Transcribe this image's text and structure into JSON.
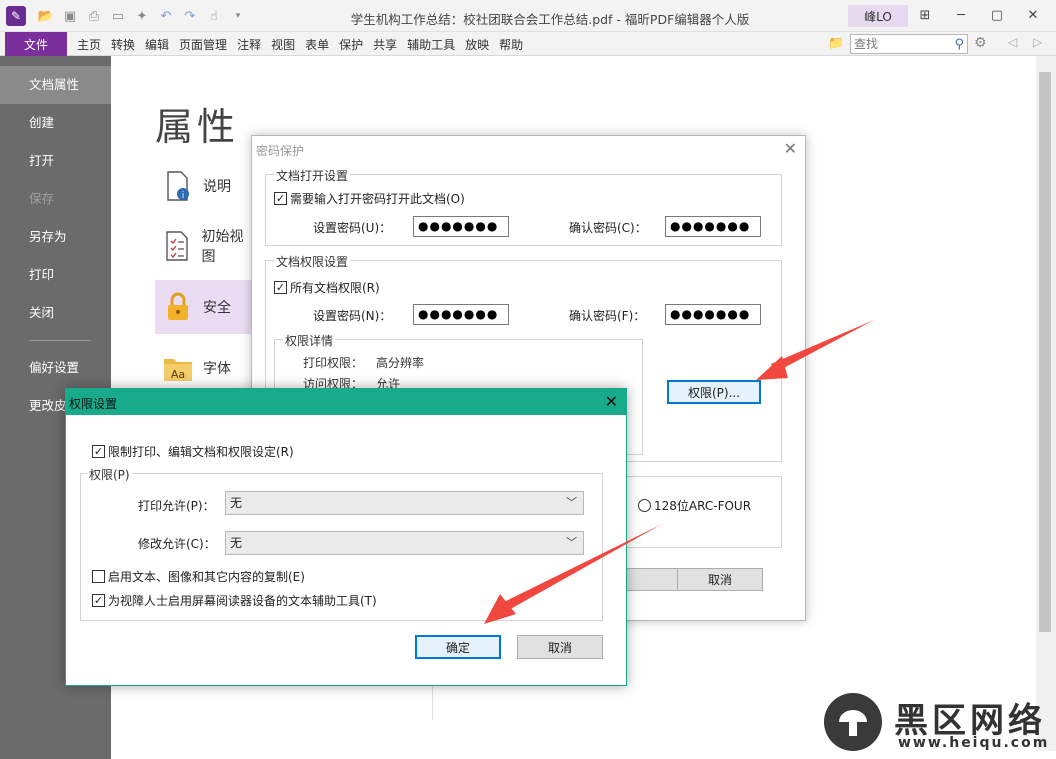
{
  "window": {
    "title": "学生机构工作总结：校社团联合会工作总结.pdf - 福昕PDF编辑器个人版",
    "user": "峰LO"
  },
  "menu": {
    "file": "文件",
    "items": [
      "主页",
      "转换",
      "编辑",
      "页面管理",
      "注释",
      "视图",
      "表单",
      "保护",
      "共享",
      "辅助工具",
      "放映",
      "帮助"
    ],
    "search_placeholder": "查找"
  },
  "sidebar": {
    "items": [
      {
        "label": "文档属性",
        "state": "active"
      },
      {
        "label": "创建",
        "state": "normal"
      },
      {
        "label": "打开",
        "state": "normal"
      },
      {
        "label": "保存",
        "state": "disabled"
      },
      {
        "label": "另存为",
        "state": "normal"
      },
      {
        "label": "打印",
        "state": "normal"
      },
      {
        "label": "关闭",
        "state": "normal"
      },
      {
        "label": "偏好设置",
        "state": "normal"
      },
      {
        "label": "更改皮",
        "state": "normal"
      }
    ]
  },
  "properties": {
    "heading": "属性",
    "items": [
      {
        "label": "说明",
        "icon": "document-info-icon"
      },
      {
        "label": "初始视图",
        "icon": "checklist-icon"
      },
      {
        "label": "安全",
        "icon": "lock-icon"
      },
      {
        "label": "字体",
        "icon": "font-folder-icon"
      }
    ]
  },
  "password_dialog": {
    "title": "密码保护",
    "open_group": "文档打开设置",
    "require_open_pwd": "需要输入打开密码打开此文档(O)",
    "set_pwd_u": "设置密码(U)：",
    "confirm_pwd_c": "确认密码(C)：",
    "pwd_value": "●●●●●●●",
    "perm_group": "文档权限设置",
    "all_perms": "所有文档权限(R)",
    "set_pwd_n": "设置密码(N)：",
    "confirm_pwd_f": "确认密码(F)：",
    "detail_group": "权限详情",
    "print_perm_label": "打印权限：",
    "print_perm_value": "高分辨率",
    "access_perm_label": "访问权限：",
    "access_perm_value": "允许",
    "perm_button": "权限(P)...",
    "encrypt_option": "128位ARC-FOUR",
    "cancel": "取消"
  },
  "permission_dialog": {
    "title": "权限设置",
    "restrict_label": "限制打印、编辑文档和权限设定(R)",
    "perm_group": "权限(P)",
    "print_allow_label": "打印允许(P)：",
    "print_allow_value": "无",
    "modify_allow_label": "修改允许(C)：",
    "modify_allow_value": "无",
    "copy_label": "启用文本、图像和其它内容的复制(E)",
    "screen_reader_label": "为视障人士启用屏幕阅读器设备的文本辅助工具(T)",
    "ok": "确定",
    "cancel": "取消"
  },
  "watermark": {
    "cn": "黑区网络",
    "url": "www.heiqu.com"
  },
  "colors": {
    "brand_purple": "#7b2f9c",
    "dialog_teal": "#18ab8b",
    "arrow_red": "#f0473f"
  }
}
